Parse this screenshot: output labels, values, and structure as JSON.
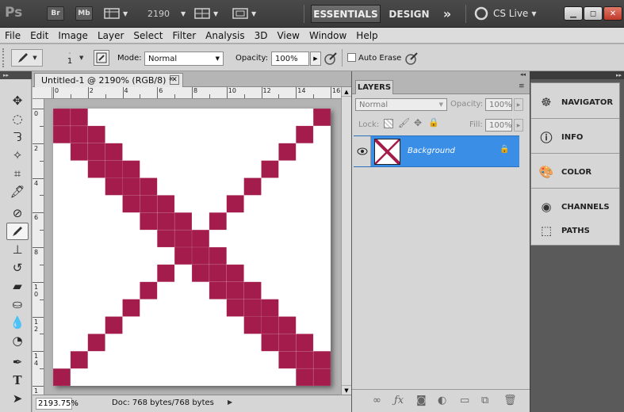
{
  "titlebar": {
    "app_logo": "Ps",
    "bridge_label": "Br",
    "minibridge_label": "Mb",
    "zoom_value": "2190",
    "workspaces": [
      "ESSENTIALS",
      "DESIGN"
    ],
    "more_label": "»",
    "cslive_label": "CS Live"
  },
  "menu": [
    "File",
    "Edit",
    "Image",
    "Layer",
    "Select",
    "Filter",
    "Analysis",
    "3D",
    "View",
    "Window",
    "Help"
  ],
  "options": {
    "brush_size": "1",
    "mode_label": "Mode:",
    "mode_value": "Normal",
    "opacity_label": "Opacity:",
    "opacity_value": "100%",
    "auto_erase_label": "Auto Erase"
  },
  "document": {
    "tab_title": "Untitled-1 @ 2190% (RGB/8) *",
    "ruler_h": [
      "0",
      "2",
      "4",
      "6",
      "8",
      "10",
      "12",
      "14",
      "16"
    ],
    "ruler_v": [
      "0",
      "2",
      "4",
      "6",
      "8",
      "1\n0",
      "1\n2",
      "1\n4",
      "1\n6"
    ],
    "zoom_status": "2193.75%",
    "doc_info": "Doc: 768 bytes/768 bytes",
    "pixel_color": "#a31c4b",
    "grid_size": 16,
    "pixels": [
      [
        0,
        0
      ],
      [
        1,
        0
      ],
      [
        15,
        0
      ],
      [
        0,
        1
      ],
      [
        1,
        1
      ],
      [
        2,
        1
      ],
      [
        14,
        1
      ],
      [
        1,
        2
      ],
      [
        2,
        2
      ],
      [
        3,
        2
      ],
      [
        13,
        2
      ],
      [
        2,
        3
      ],
      [
        3,
        3
      ],
      [
        4,
        3
      ],
      [
        12,
        3
      ],
      [
        3,
        4
      ],
      [
        4,
        4
      ],
      [
        5,
        4
      ],
      [
        11,
        4
      ],
      [
        4,
        5
      ],
      [
        5,
        5
      ],
      [
        6,
        5
      ],
      [
        10,
        5
      ],
      [
        5,
        6
      ],
      [
        6,
        6
      ],
      [
        7,
        6
      ],
      [
        9,
        6
      ],
      [
        6,
        7
      ],
      [
        7,
        7
      ],
      [
        8,
        7
      ],
      [
        7,
        8
      ],
      [
        8,
        8
      ],
      [
        9,
        8
      ],
      [
        6,
        9
      ],
      [
        8,
        9
      ],
      [
        9,
        9
      ],
      [
        10,
        9
      ],
      [
        5,
        10
      ],
      [
        9,
        10
      ],
      [
        10,
        10
      ],
      [
        11,
        10
      ],
      [
        4,
        11
      ],
      [
        10,
        11
      ],
      [
        11,
        11
      ],
      [
        12,
        11
      ],
      [
        3,
        12
      ],
      [
        11,
        12
      ],
      [
        12,
        12
      ],
      [
        13,
        12
      ],
      [
        2,
        13
      ],
      [
        12,
        13
      ],
      [
        13,
        13
      ],
      [
        14,
        13
      ],
      [
        1,
        14
      ],
      [
        13,
        14
      ],
      [
        14,
        14
      ],
      [
        15,
        14
      ],
      [
        0,
        15
      ],
      [
        14,
        15
      ],
      [
        15,
        15
      ]
    ]
  },
  "layers_panel": {
    "tab_label": "LAYERS",
    "blend_mode": "Normal",
    "opacity_label": "Opacity:",
    "opacity_value": "100%",
    "lock_label": "Lock:",
    "fill_label": "Fill:",
    "fill_value": "100%",
    "layer_name": "Background"
  },
  "dock": [
    "NAVIGATOR",
    "INFO",
    "COLOR",
    "CHANNELS",
    "PATHS"
  ],
  "colors": {
    "accent_blue": "#3a8ee6",
    "pixel": "#a31c4b"
  }
}
